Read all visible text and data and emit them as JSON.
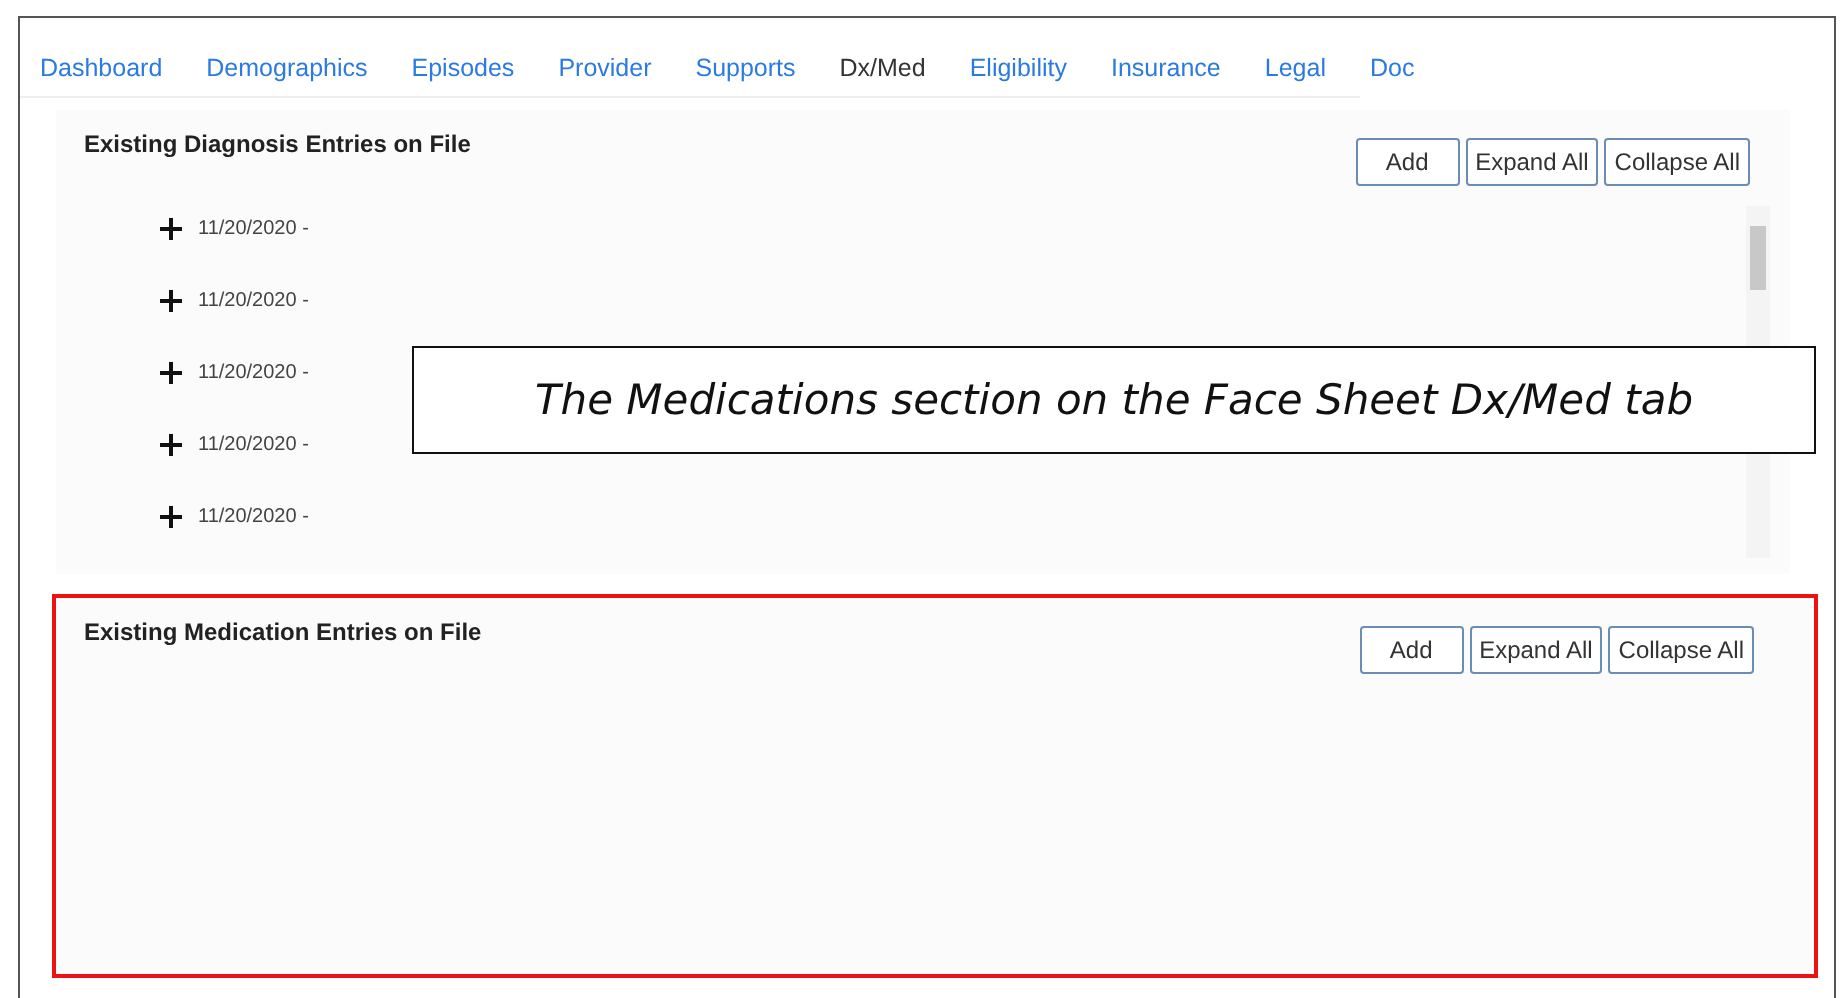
{
  "tabs": [
    {
      "label": "Dashboard",
      "selected": false
    },
    {
      "label": "Demographics",
      "selected": false
    },
    {
      "label": "Episodes",
      "selected": false
    },
    {
      "label": "Provider",
      "selected": false
    },
    {
      "label": "Supports",
      "selected": false
    },
    {
      "label": "Dx/Med",
      "selected": true
    },
    {
      "label": "Eligibility",
      "selected": false
    },
    {
      "label": "Insurance",
      "selected": false
    },
    {
      "label": "Legal",
      "selected": false
    },
    {
      "label": "Doc",
      "selected": false
    }
  ],
  "sections": [
    {
      "title": "Existing Diagnosis Entries on File",
      "buttons": [
        "Add",
        "Expand All",
        "Collapse All"
      ],
      "highlighted": false,
      "entries": [
        {
          "label": "11/20/2020 -",
          "expanded": false
        },
        {
          "label": "11/20/2020 -",
          "expanded": false
        },
        {
          "label": "11/20/2020 -",
          "expanded": false
        },
        {
          "label": "11/20/2020 -",
          "expanded": false
        },
        {
          "label": "11/20/2020 -",
          "expanded": false
        }
      ]
    },
    {
      "title": "Existing Medication Entries on File",
      "buttons": [
        "Add",
        "Expand All",
        "Collapse All"
      ],
      "highlighted": true
    }
  ],
  "callout": "The Medications section on the Face Sheet Dx/Med tab"
}
